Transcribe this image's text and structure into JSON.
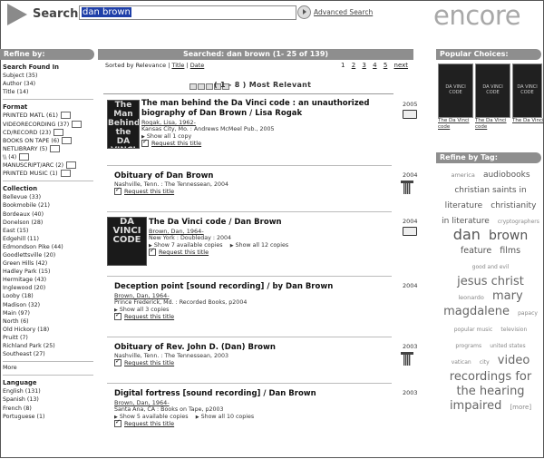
{
  "header": {
    "search_label": "Search:",
    "search_value": "dan brown",
    "advanced_label": "Advanced Search",
    "logo": "encore"
  },
  "left": {
    "bar_label": "Refine by:",
    "sections": [
      {
        "heading": "Search Found In",
        "items": [
          "Subject (35)",
          "Author (34)",
          "Title (14)"
        ]
      },
      {
        "heading": "Format",
        "items": [
          "PRINTED MATL (61)",
          "VIDEORECORDING (37)",
          "CD/RECORD (23)",
          "BOOKS ON TAPE (6)",
          "NETLIBRARY (5)",
          "\\\\ (4)",
          "MANUSCRIPT/ARC (2)",
          "PRINTED MUSIC (1)"
        ]
      },
      {
        "heading": "Collection",
        "items": [
          "Bellevue (33)",
          "Bookmobile (21)",
          "Bordeaux (40)",
          "Donelson (28)",
          "East (15)",
          "Edgehill (11)",
          "Edmondson Pike (44)",
          "Goodlettsville (20)",
          "Green Hills (42)",
          "Hadley Park (15)",
          "Hermitage (43)",
          "Inglewood (20)",
          "Looby (18)",
          "Madison (32)",
          "Main (97)",
          "North (6)",
          "Old Hickory (18)",
          "Pruitt (7)",
          "Richland Park (25)",
          "Southeast (27)"
        ]
      },
      {
        "heading": "",
        "items": [
          "More"
        ]
      },
      {
        "heading": "Language",
        "items": [
          "English (131)",
          "Spanish (13)",
          "French (8)",
          "Portuguese (1)"
        ]
      }
    ]
  },
  "center": {
    "bar_label": "Searched: dan brown (1- 25 of 139)",
    "sort_prefix": "Sorted by",
    "sort_options": [
      "Relevance",
      "Title",
      "Date"
    ],
    "pages": [
      "1",
      "2",
      "3",
      "4",
      "5",
      "next"
    ],
    "relevance_label": "( 1 - 8 ) Most Relevant",
    "records": [
      {
        "title1": "The man behind the Da Vinci code : an unauthorized",
        "title2": "biography of Dan Brown / Lisa Rogak",
        "author": "Rogak, Lisa, 1962-",
        "pub": "Kansas City, Mo. : Andrews McMeel Pub., 2005",
        "show1": "Show all 1 copy",
        "show2": "",
        "request": "Request this title",
        "year": "2005"
      },
      {
        "title1": "Obituary of Dan Brown",
        "title2": "",
        "author": "",
        "pub": "Nashville, Tenn. : The Tennessean, 2004",
        "show1": "",
        "show2": "",
        "request": "Request this title",
        "year": "2004"
      },
      {
        "title1": "The Da Vinci code / Dan Brown",
        "title2": "",
        "author": "Brown, Dan, 1964-",
        "pub": "New York : Doubleday : 2004",
        "show1": "Show 7 available copies",
        "show2": "Show all 12 copies",
        "request": "Request this title",
        "year": "2004"
      },
      {
        "title1": "Deception point [sound recording] / by Dan Brown",
        "title2": "",
        "author": "Brown, Dan, 1964-",
        "pub": "Prince Frederick, Md. : Recorded Books, p2004",
        "show1": "Show all 3 copies",
        "show2": "",
        "request": "Request this title",
        "year": "2004"
      },
      {
        "title1": "Obituary of Rev. John D. (Dan) Brown",
        "title2": "",
        "author": "",
        "pub": "Nashville, Tenn. : The Tennessean, 2003",
        "show1": "",
        "show2": "",
        "request": "Request this title",
        "year": "2003"
      },
      {
        "title1": "Digital fortress [sound recording] / Dan Brown",
        "title2": "",
        "author": "Brown, Dan, 1964-",
        "pub": "Santa Ana, CA : Books on Tape, p2003",
        "show1": "Show 5 available copies",
        "show2": "Show all 10 copies",
        "request": "Request this title",
        "year": "2003"
      }
    ],
    "cover1": "The Man Behind the DA VINCI CODE",
    "cover2": "DA VINCI CODE"
  },
  "right": {
    "popular_label": "Popular Choices:",
    "popular": [
      {
        "caption": "The Da Vinci code",
        "cover": "DA VINCI CODE"
      },
      {
        "caption": "The Da Vinci code",
        "cover": "DA VINCI CODE"
      },
      {
        "caption": "The Da Vinci",
        "cover": "DA VINCI CODE"
      }
    ],
    "tag_label": "Refine by Tag:",
    "tags": [
      {
        "t": "america",
        "s": 6.5,
        "c": "#888"
      },
      {
        "t": "audiobooks",
        "s": 9,
        "c": "#555"
      },
      {
        "t": "christian saints in",
        "s": 9,
        "c": "#555"
      },
      {
        "t": "literature",
        "s": 9,
        "c": "#555"
      },
      {
        "t": "christianity",
        "s": 9,
        "c": "#555"
      },
      {
        "t": "in literature",
        "s": 9,
        "c": "#555"
      },
      {
        "t": "cryptographers",
        "s": 6,
        "c": "#888"
      },
      {
        "t": "dan",
        "s": 16,
        "c": "#555"
      },
      {
        "t": "brown",
        "s": 14,
        "c": "#555"
      },
      {
        "t": "feature",
        "s": 9.5,
        "c": "#555"
      },
      {
        "t": "films",
        "s": 9.5,
        "c": "#555"
      },
      {
        "t": "good and evil",
        "s": 6,
        "c": "#888"
      },
      {
        "t": "jesus christ",
        "s": 13,
        "c": "#666"
      },
      {
        "t": "leonardo",
        "s": 6.5,
        "c": "#888"
      },
      {
        "t": "mary",
        "s": 13,
        "c": "#666"
      },
      {
        "t": "magdalene",
        "s": 13,
        "c": "#666"
      },
      {
        "t": "papacy",
        "s": 6,
        "c": "#888"
      },
      {
        "t": "popular music",
        "s": 6,
        "c": "#888"
      },
      {
        "t": "television",
        "s": 6,
        "c": "#888"
      },
      {
        "t": "programs",
        "s": 6,
        "c": "#888"
      },
      {
        "t": "united states",
        "s": 6,
        "c": "#888"
      },
      {
        "t": "vatican",
        "s": 6,
        "c": "#888"
      },
      {
        "t": "city",
        "s": 6,
        "c": "#888"
      },
      {
        "t": "video",
        "s": 13,
        "c": "#666"
      },
      {
        "t": "recordings for",
        "s": 13,
        "c": "#666"
      },
      {
        "t": "the hearing",
        "s": 13,
        "c": "#666"
      },
      {
        "t": "impaired",
        "s": 13,
        "c": "#666"
      },
      {
        "t": "[more]",
        "s": 7,
        "c": "#888"
      }
    ]
  }
}
